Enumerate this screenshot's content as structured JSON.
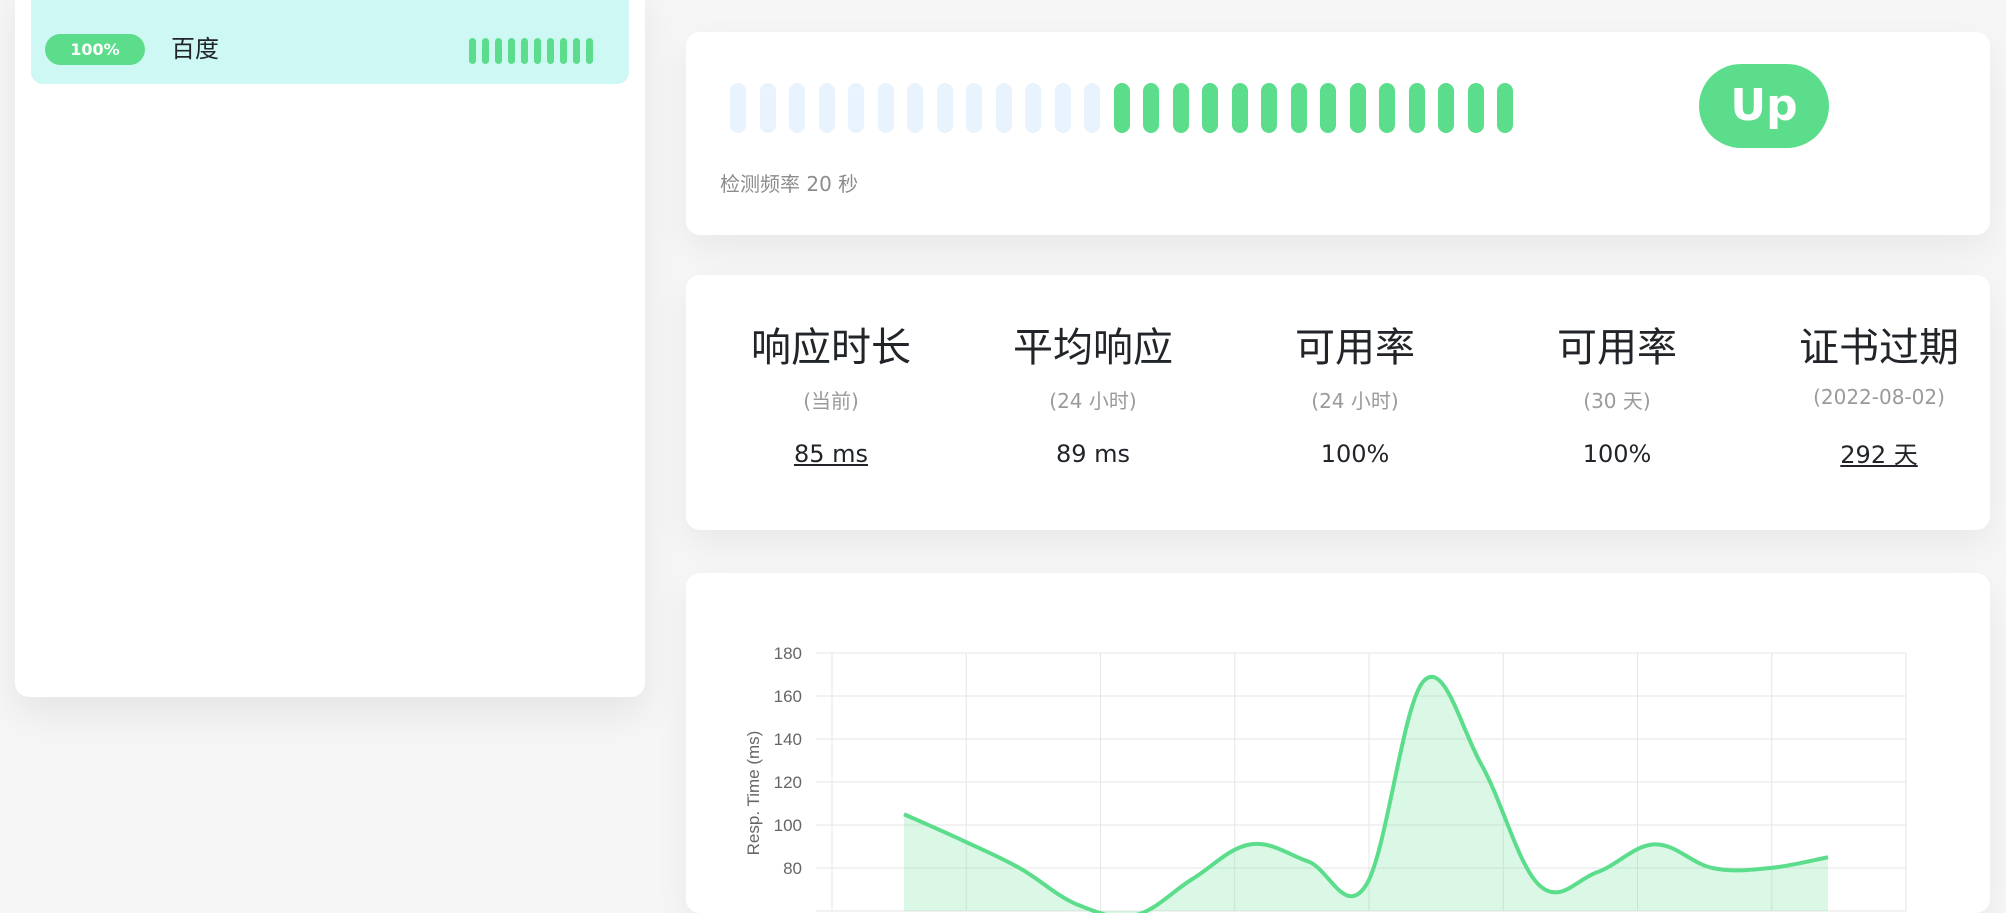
{
  "monitor_list": {
    "items": [
      {
        "uptime_badge": "100%",
        "name": "百度",
        "beats": 10
      }
    ]
  },
  "heartbeat": {
    "empty_count": 13,
    "up_count": 14,
    "status_badge": "Up",
    "check_interval": "检测频率 20 秒"
  },
  "stats": [
    {
      "title": "响应时长",
      "subtitle": "(当前)",
      "value": "85 ms",
      "link": true
    },
    {
      "title": "平均响应",
      "subtitle": "(24 小时)",
      "value": "89 ms",
      "link": false
    },
    {
      "title": "可用率",
      "subtitle": "(24 小时)",
      "value": "100%",
      "link": false
    },
    {
      "title": "可用率",
      "subtitle": "(30 天)",
      "value": "100%",
      "link": false
    },
    {
      "title": "证书过期",
      "subtitle": "(2022-08-02)",
      "value": "292 天",
      "link": true
    }
  ],
  "colors": {
    "up": "#5cdd8b",
    "empty_beat": "#e9f3fd",
    "selected_item": "#cdf8f4"
  },
  "chart_data": {
    "type": "area",
    "ylabel": "Resp. Time (ms)",
    "y_ticks": [
      80,
      100,
      120,
      140,
      160,
      180
    ],
    "ylim": [
      60,
      180
    ],
    "grid": true,
    "series": [
      {
        "values": [
          105,
          93,
          80,
          63,
          58,
          75,
          91,
          83,
          72,
          167,
          128,
          72,
          78,
          91,
          80,
          80,
          85
        ]
      }
    ],
    "color": "#5cdd8b"
  }
}
